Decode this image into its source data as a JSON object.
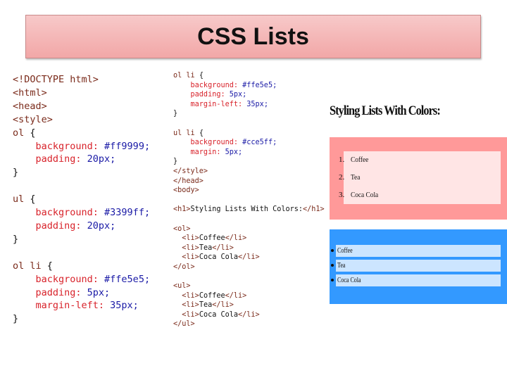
{
  "slide": {
    "title": "CSS Lists"
  },
  "code_left": [
    [
      {
        "t": "<!DOCTYPE html>",
        "c": "tag"
      }
    ],
    [
      {
        "t": "<html>",
        "c": "tag"
      }
    ],
    [
      {
        "t": "<head>",
        "c": "tag"
      }
    ],
    [
      {
        "t": "<style>",
        "c": "tag"
      }
    ],
    [
      {
        "t": "ol ",
        "c": "sel"
      },
      {
        "t": "{",
        "c": "punc"
      }
    ],
    [
      {
        "t": "    background: ",
        "c": "prop"
      },
      {
        "t": "#ff9999;",
        "c": "val"
      }
    ],
    [
      {
        "t": "    padding: ",
        "c": "prop"
      },
      {
        "t": "20px;",
        "c": "val"
      }
    ],
    [
      {
        "t": "}",
        "c": "punc"
      }
    ],
    [
      {
        "t": "",
        "c": "punc"
      }
    ],
    [
      {
        "t": "ul ",
        "c": "sel"
      },
      {
        "t": "{",
        "c": "punc"
      }
    ],
    [
      {
        "t": "    background: ",
        "c": "prop"
      },
      {
        "t": "#3399ff;",
        "c": "val"
      }
    ],
    [
      {
        "t": "    padding: ",
        "c": "prop"
      },
      {
        "t": "20px;",
        "c": "val"
      }
    ],
    [
      {
        "t": "}",
        "c": "punc"
      }
    ],
    [
      {
        "t": "",
        "c": "punc"
      }
    ],
    [
      {
        "t": "ol li ",
        "c": "sel"
      },
      {
        "t": "{",
        "c": "punc"
      }
    ],
    [
      {
        "t": "    background: ",
        "c": "prop"
      },
      {
        "t": "#ffe5e5;",
        "c": "val"
      }
    ],
    [
      {
        "t": "    padding: ",
        "c": "prop"
      },
      {
        "t": "5px;",
        "c": "val"
      }
    ],
    [
      {
        "t": "    margin-left: ",
        "c": "prop"
      },
      {
        "t": "35px;",
        "c": "val"
      }
    ],
    [
      {
        "t": "}",
        "c": "punc"
      }
    ]
  ],
  "code_right": [
    [
      {
        "t": "ol li ",
        "c": "sel"
      },
      {
        "t": "{",
        "c": "punc"
      }
    ],
    [
      {
        "t": "    background: ",
        "c": "prop"
      },
      {
        "t": "#ffe5e5;",
        "c": "val"
      }
    ],
    [
      {
        "t": "    padding: ",
        "c": "prop"
      },
      {
        "t": "5px;",
        "c": "val"
      }
    ],
    [
      {
        "t": "    margin-left: ",
        "c": "prop"
      },
      {
        "t": "35px;",
        "c": "val"
      }
    ],
    [
      {
        "t": "}",
        "c": "punc"
      }
    ],
    [
      {
        "t": "",
        "c": "punc"
      }
    ],
    [
      {
        "t": "ul li ",
        "c": "sel"
      },
      {
        "t": "{",
        "c": "punc"
      }
    ],
    [
      {
        "t": "    background: ",
        "c": "prop"
      },
      {
        "t": "#cce5ff;",
        "c": "val"
      }
    ],
    [
      {
        "t": "    margin: ",
        "c": "prop"
      },
      {
        "t": "5px;",
        "c": "val"
      }
    ],
    [
      {
        "t": "}",
        "c": "punc"
      }
    ],
    [
      {
        "t": "</style>",
        "c": "tag"
      }
    ],
    [
      {
        "t": "</head>",
        "c": "tag"
      }
    ],
    [
      {
        "t": "<body>",
        "c": "tag"
      }
    ],
    [
      {
        "t": "",
        "c": "punc"
      }
    ],
    [
      {
        "t": "<h1>",
        "c": "tag"
      },
      {
        "t": "Styling Lists With Colors:",
        "c": "txt"
      },
      {
        "t": "</h1>",
        "c": "tag"
      }
    ],
    [
      {
        "t": "",
        "c": "punc"
      }
    ],
    [
      {
        "t": "<ol>",
        "c": "tag"
      }
    ],
    [
      {
        "t": "  <li>",
        "c": "tag"
      },
      {
        "t": "Coffee",
        "c": "txt"
      },
      {
        "t": "</li>",
        "c": "tag"
      }
    ],
    [
      {
        "t": "  <li>",
        "c": "tag"
      },
      {
        "t": "Tea",
        "c": "txt"
      },
      {
        "t": "</li>",
        "c": "tag"
      }
    ],
    [
      {
        "t": "  <li>",
        "c": "tag"
      },
      {
        "t": "Coca Cola",
        "c": "txt"
      },
      {
        "t": "</li>",
        "c": "tag"
      }
    ],
    [
      {
        "t": "</ol>",
        "c": "tag"
      }
    ],
    [
      {
        "t": "",
        "c": "punc"
      }
    ],
    [
      {
        "t": "<ul>",
        "c": "tag"
      }
    ],
    [
      {
        "t": "  <li>",
        "c": "tag"
      },
      {
        "t": "Coffee",
        "c": "txt"
      },
      {
        "t": "</li>",
        "c": "tag"
      }
    ],
    [
      {
        "t": "  <li>",
        "c": "tag"
      },
      {
        "t": "Tea",
        "c": "txt"
      },
      {
        "t": "</li>",
        "c": "tag"
      }
    ],
    [
      {
        "t": "  <li>",
        "c": "tag"
      },
      {
        "t": "Coca Cola",
        "c": "txt"
      },
      {
        "t": "</li>",
        "c": "tag"
      }
    ],
    [
      {
        "t": "</ul>",
        "c": "tag"
      }
    ]
  ],
  "preview": {
    "heading": "Styling Lists With Colors:",
    "ordered_list": [
      {
        "marker": "1.",
        "label": "Coffee"
      },
      {
        "marker": "2.",
        "label": "Tea"
      },
      {
        "marker": "3.",
        "label": "Coca Cola"
      }
    ],
    "unordered_list": [
      "Coffee",
      "Tea",
      "Coca Cola"
    ]
  },
  "colors": {
    "ol_background": "#ff9999",
    "ol_item_background": "#ffe5e5",
    "ul_background": "#3399ff",
    "ul_item_background": "#cce5ff"
  }
}
